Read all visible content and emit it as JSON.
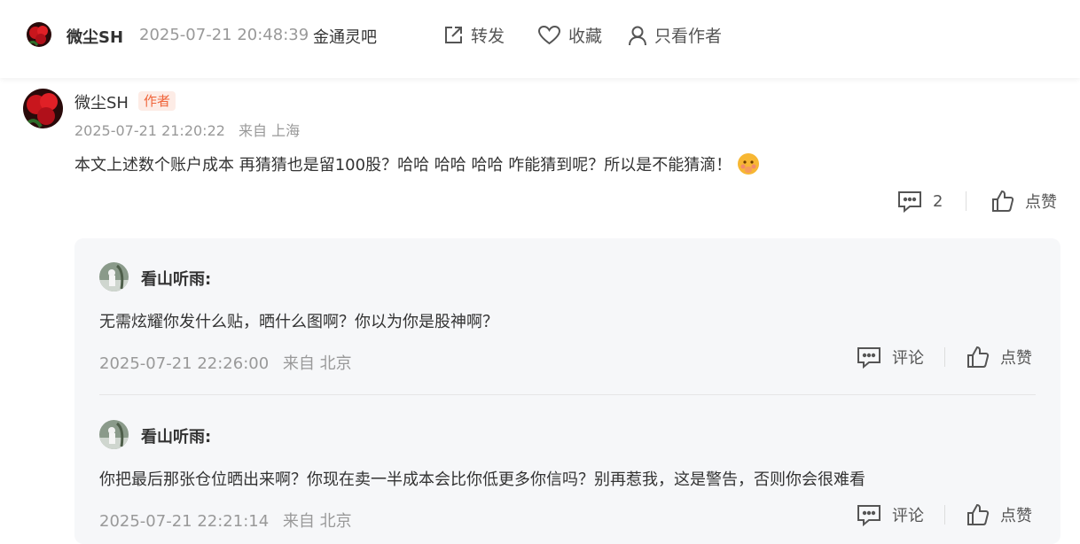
{
  "header": {
    "username": "微尘SH",
    "timestamp": "2025-07-21 20:48:39",
    "bar_name": "金通灵吧",
    "share_label": "转发",
    "favorite_label": "收藏",
    "author_only_label": "只看作者"
  },
  "post": {
    "username": "微尘SH",
    "badge": "作者",
    "timestamp": "2025-07-21 21:20:22",
    "location": "来自 上海",
    "body": "本文上述数个账户成本 再猜猜也是留100股？哈哈 哈哈 哈哈 咋能猜到呢？所以是不能猜滴！",
    "comment_count": "2",
    "like_label": "点赞"
  },
  "replies": [
    {
      "username": "看山听雨:",
      "text": "无需炫耀你发什么贴，晒什么图啊？你以为你是股神啊？",
      "timestamp": "2025-07-21 22:26:00",
      "location": "来自 北京",
      "comment_label": "评论",
      "like_label": "点赞"
    },
    {
      "username": "看山听雨:",
      "text": "你把最后那张仓位晒出来啊？你现在卖一半成本会比你低更多你信吗？别再惹我，这是警告，否则你会很难看",
      "timestamp": "2025-07-21 22:21:14",
      "location": "来自 北京",
      "comment_label": "评论",
      "like_label": "点赞"
    }
  ],
  "colors": {
    "badge_text": "#f0653b",
    "badge_bg": "#fdece6",
    "reply_panel_bg": "#f6f7f9",
    "muted_text": "#999999"
  },
  "icons": [
    "share-icon",
    "heart-icon",
    "user-icon",
    "comment-icon",
    "thumbs-up-icon",
    "emoji-icon"
  ]
}
